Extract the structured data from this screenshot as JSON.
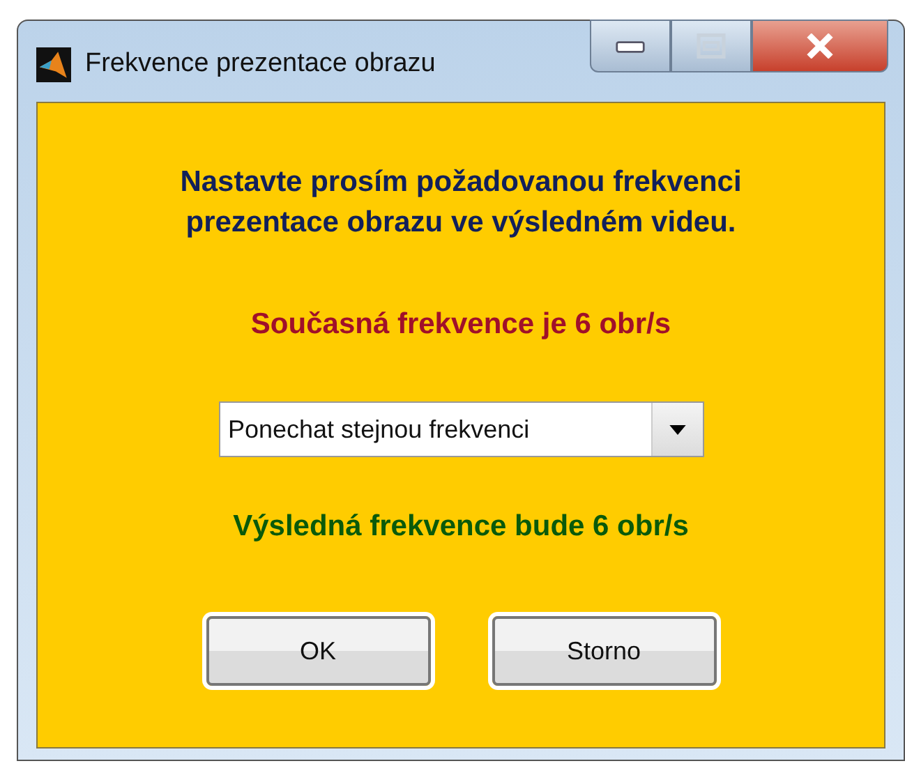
{
  "window": {
    "title": "Frekvence prezentace obrazu"
  },
  "instruction": "Nastavte prosím požadovanou frekvenci prezentace obrazu ve výsledném videu.",
  "current_rate": "Současná frekvence je 6 obr/s",
  "dropdown": {
    "value": "Ponechat stejnou frekvenci"
  },
  "result_rate": "Výsledná frekvence bude 6 obr/s",
  "buttons": [
    "OK",
    "Storno"
  ]
}
